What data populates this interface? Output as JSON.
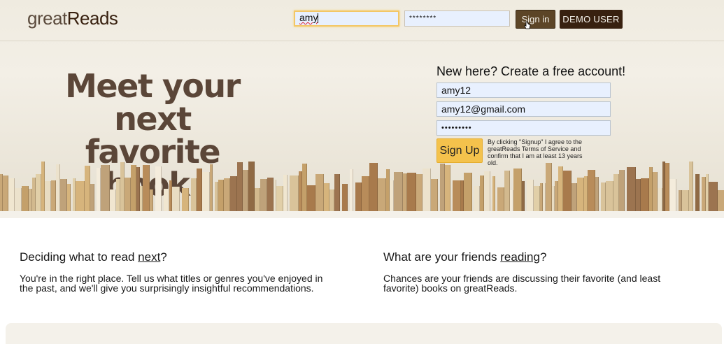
{
  "header": {
    "logo_light": "great",
    "logo_dark": "Reads",
    "username_value": "amy",
    "password_mask": "********",
    "signin_label": "Sign in",
    "demo_label": "DEMO USER"
  },
  "hero": {
    "tagline_line1": "Meet your next",
    "tagline_line2": "favorite book."
  },
  "signup": {
    "title": "New here? Create a free account!",
    "name_value": "amy12",
    "email_value": "amy12@gmail.com",
    "password_mask": "•••••••••",
    "button_label": "Sign Up",
    "terms_text": "By clicking \"Signup\" I agree to the greatReads Terms of Service and confirm that I am at least 13 years old."
  },
  "features": {
    "col1_title_prefix": "Deciding what to read ",
    "col1_title_link": "next",
    "col1_title_suffix": "?",
    "col1_text": "You're in the right place. Tell us what titles or genres you've enjoyed in the past, and we'll give you surprisingly insightful recommendations.",
    "col2_title_prefix": "What are your friends ",
    "col2_title_link": "reading",
    "col2_title_suffix": "?",
    "col2_text": "Chances are your friends are discussing their favorite (and least favorite) books on greatReads."
  },
  "colors": {
    "brand_dark": "#382110",
    "signin_bg": "#5c4527",
    "signup_bg": "#f4c24c",
    "tagline": "#5b4638"
  }
}
